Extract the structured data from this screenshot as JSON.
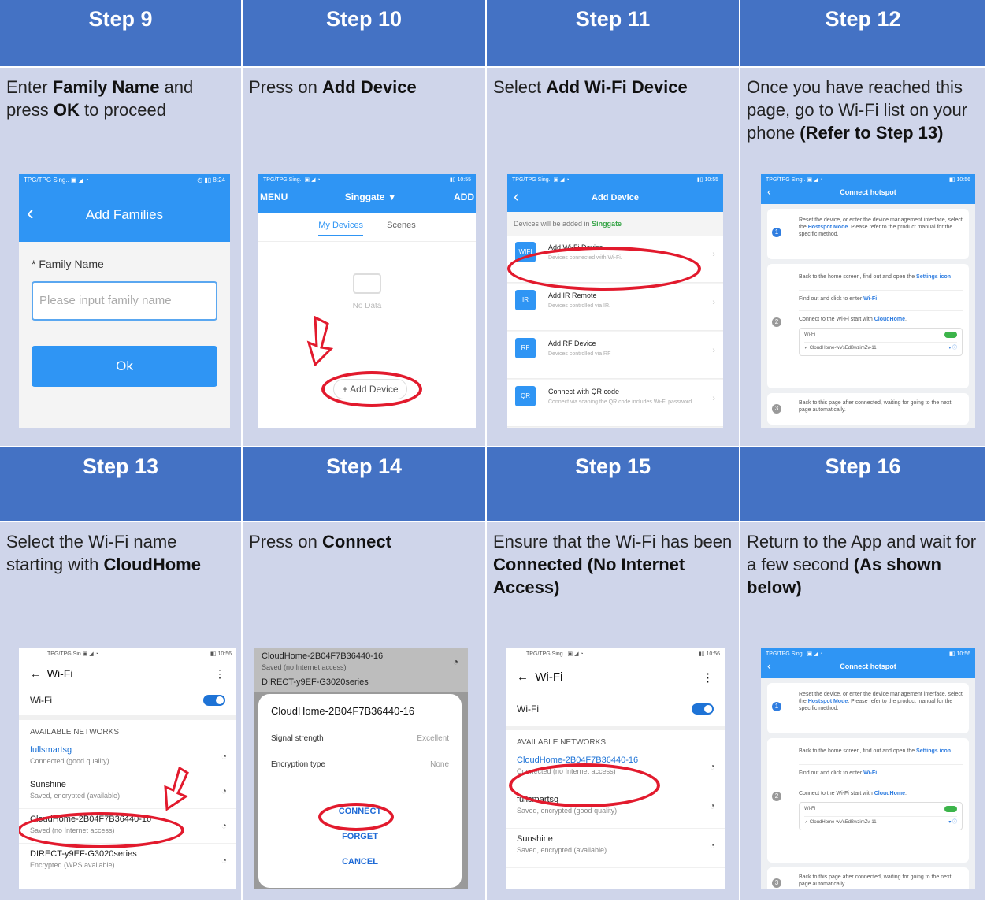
{
  "steps": [
    {
      "title": "Step 9",
      "desc_parts": [
        "Enter ",
        "Family Name",
        " and press ",
        "OK",
        " to proceed"
      ]
    },
    {
      "title": "Step 10",
      "desc_parts": [
        "Press on ",
        "Add Device"
      ]
    },
    {
      "title": "Step 11",
      "desc_parts": [
        "Select ",
        "Add Wi-Fi Device"
      ]
    },
    {
      "title": "Step 12",
      "desc_parts": [
        "Once you have reached this page, go to Wi-Fi list on your phone ",
        "(Refer to Step 13)"
      ]
    },
    {
      "title": "Step 13",
      "desc_parts": [
        "Select the Wi-Fi name starting with ",
        "CloudHome"
      ]
    },
    {
      "title": "Step 14",
      "desc_parts": [
        "Press on ",
        "Connect"
      ]
    },
    {
      "title": "Step 15",
      "desc_parts": [
        "Ensure that the Wi-Fi has been ",
        "Connected (No Internet Access)"
      ]
    },
    {
      "title": "Step 16",
      "desc_parts": [
        "Return to the App and wait for a few second ",
        "(As shown below)"
      ]
    }
  ],
  "s9": {
    "status_l": "TPG/TPG Sing.. ▣ ◢ ◔",
    "status_r": "◷ ▮▯ 8:24",
    "title": "Add Families",
    "label": "* Family Name",
    "placeholder": "Please input family name",
    "ok": "Ok"
  },
  "s10": {
    "status_l": "TPG/TPG Sing.. ▣ ◢ ◔",
    "status_r": "▮▯ 10:55",
    "menu": "MENU",
    "home": "Singgate ▼",
    "add": "ADD",
    "tab1": "My Devices",
    "tab2": "Scenes",
    "nodata": "No Data",
    "add_device": "+ Add Device"
  },
  "s11": {
    "status_l": "TPG/TPG Sing.. ▣ ◢ ◔",
    "status_r": "▮▯ 10:55",
    "title": "Add Device",
    "note": "Devices will be added in ",
    "home": "Singgate",
    "items": [
      {
        "icon": "WIFI",
        "name": "Add Wi-Fi Device",
        "sub": "Devices connected with Wi-Fi."
      },
      {
        "icon": "IR",
        "name": "Add IR Remote",
        "sub": "Devices controlled via IR."
      },
      {
        "icon": "RF",
        "name": "Add RF Device",
        "sub": "Devices controlled via RF"
      },
      {
        "icon": "QR",
        "name": "Connect with QR code",
        "sub": "Connect via scaning the QR code includes Wi-Fi password"
      }
    ]
  },
  "hotspot": {
    "status_l": "TPG/TPG Sing.. ▣ ◢ ◔",
    "status_r": "▮▯ 10:56",
    "title": "Connect hotspot",
    "c1": [
      "Reset the device, or enter the device management interface, select the ",
      "Hostspot Mode",
      ". Please refer to the product manual for the specific method."
    ],
    "c2a": [
      "Back to the home screen, find out and open the ",
      "Settings icon"
    ],
    "c2b": [
      "Find out and click to enter ",
      "Wi-Fi"
    ],
    "c2c": [
      "Connect to the Wi-Fi start with ",
      "CloudHome",
      "."
    ],
    "wifi_label": "Wi-Fi",
    "wifi_net": "✓  CloudHome-wVsEdBwzimZv-11",
    "wifi_icons": "▾ ⓘ",
    "c3": "Back to this page after connected, waiting for going to the next page automatically."
  },
  "s13": {
    "status_l": "TPG/TPG Sin ▣ ◢ ◔",
    "status_r": "▮▯ 10:56",
    "title": "Wi-Fi",
    "wifi": "Wi-Fi",
    "avail": "AVAILABLE NETWORKS",
    "nets": [
      {
        "name": "fullsmartsg",
        "sub": "Connected (good quality)"
      },
      {
        "name": "Sunshine",
        "sub": "Saved, encrypted (available)"
      },
      {
        "name": "CloudHome-2B04F7B36440-16",
        "sub": "Saved (no Internet access)"
      },
      {
        "name": "DIRECT-y9EF-G3020series",
        "sub": "Encrypted (WPS available)"
      }
    ]
  },
  "s14": {
    "bg1": "CloudHome-2B04F7B36440-16",
    "bg1s": "Saved (no Internet access)",
    "bg2": "DIRECT-y9EF-G3020series",
    "dlg_title": "CloudHome-2B04F7B36440-16",
    "sig_l": "Signal strength",
    "sig_v": "Excellent",
    "enc_l": "Encryption type",
    "enc_v": "None",
    "connect": "CONNECT",
    "forget": "FORGET",
    "cancel": "CANCEL"
  },
  "s15": {
    "status_l": "TPG/TPG Sing.. ▣ ◢ ◔",
    "status_r": "▮▯ 10:56",
    "title": "Wi-Fi",
    "wifi": "Wi-Fi",
    "avail": "AVAILABLE NETWORKS",
    "nets": [
      {
        "name": "CloudHome-2B04F7B36440-16",
        "sub": "Connected (no Internet access)"
      },
      {
        "name": "fullsmartsg",
        "sub": "Saved, encrypted (good quality)"
      },
      {
        "name": "Sunshine",
        "sub": "Saved, encrypted (available)"
      }
    ]
  }
}
